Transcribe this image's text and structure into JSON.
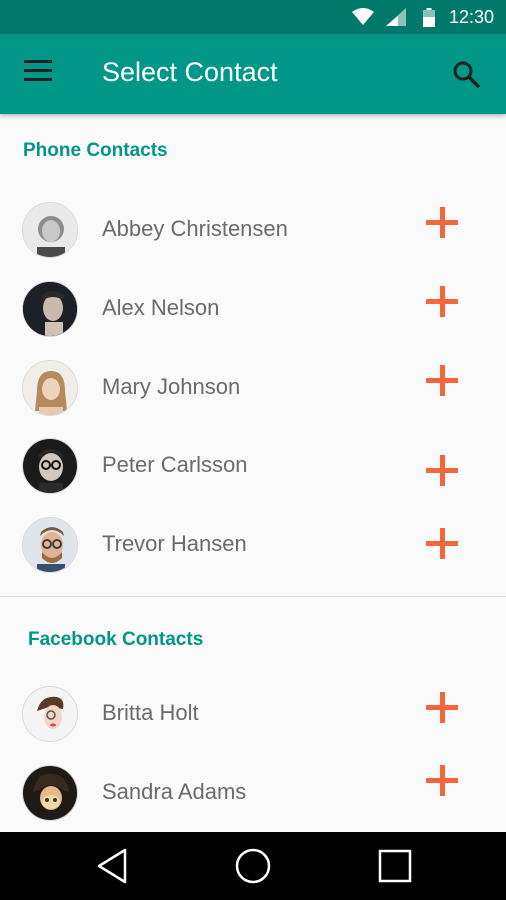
{
  "status_bar": {
    "time": "12:30"
  },
  "app_bar": {
    "title": "Select Contact"
  },
  "sections": [
    {
      "header": "Phone Contacts",
      "contacts": [
        {
          "name": "Abbey Christensen"
        },
        {
          "name": "Alex Nelson"
        },
        {
          "name": "Mary Johnson"
        },
        {
          "name": "Peter Carlsson"
        },
        {
          "name": "Trevor Hansen"
        }
      ]
    },
    {
      "header": "Facebook Contacts",
      "contacts": [
        {
          "name": "Britta Holt"
        },
        {
          "name": "Sandra Adams"
        }
      ]
    }
  ],
  "colors": {
    "primary": "#009688",
    "primary_dark": "#00796b",
    "accent": "#f4663c",
    "text_secondary": "#6b6b6b"
  },
  "icons": {
    "status": [
      "wifi-icon",
      "cell-signal-icon",
      "battery-icon"
    ],
    "app_bar": [
      "menu-icon",
      "search-icon"
    ],
    "row_action": "add-icon",
    "nav": [
      "back-icon",
      "home-icon",
      "recents-icon"
    ]
  }
}
